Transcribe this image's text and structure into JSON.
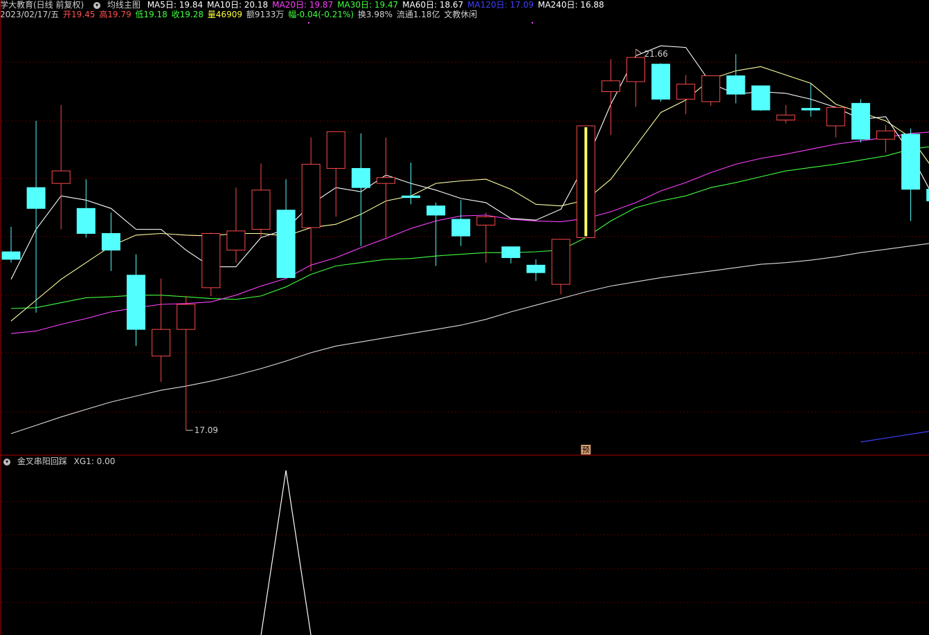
{
  "header": {
    "stock_name": "学大教育(日线 前复权)",
    "indicator_name": "均线主图",
    "ma": [
      {
        "label": "MA5日: 19.84",
        "color": "#ffffff"
      },
      {
        "label": "MA10日: 20.18",
        "color": "#ffffff"
      },
      {
        "label": "MA20日: 19.87",
        "color": "#ff40ff"
      },
      {
        "label": "MA30日: 19.47",
        "color": "#40ff40"
      },
      {
        "label": "MA60日: 18.67",
        "color": "#ffffff"
      },
      {
        "label": "MA120日: 17.09",
        "color": "#4040ff"
      },
      {
        "label": "MA240日: 16.88",
        "color": "#ffffff"
      }
    ]
  },
  "quote": {
    "date": "2023/02/17/五",
    "open": "开19.45",
    "high": "高19.79",
    "low": "低19.18",
    "close": "收19.28",
    "volume": "量46909",
    "amount": "额9133万",
    "change": "幅-0.04(-0.21%)",
    "turnover": "换3.98%",
    "float": "流通1.18亿",
    "sector": "文教休闲"
  },
  "sub_indicator": {
    "name": "金叉串阳回踩",
    "value_label": "XG1: 0.00"
  },
  "colors": {
    "up": "#ff4a4a",
    "down": "#54ffff",
    "highlight": "#ffff66",
    "grid": "#5a0000",
    "ma5": "#ffffff",
    "ma10": "#ffffa0",
    "ma20": "#ff40ff",
    "ma30": "#40ff40",
    "ma60": "#dddddd",
    "ma120": "#4040ff"
  },
  "chart_data": {
    "type": "candlestick",
    "ylim": [
      16.9,
      22.0
    ],
    "max_label": "21.66",
    "min_label": "17.09",
    "forecast_marker": "预",
    "candles": [
      {
        "o": 19.23,
        "h": 19.53,
        "l": 19.1,
        "c": 19.14
      },
      {
        "o": 20.0,
        "h": 20.8,
        "l": 18.5,
        "c": 19.75
      },
      {
        "o": 20.05,
        "h": 20.99,
        "l": 19.5,
        "c": 20.2
      },
      {
        "o": 19.75,
        "h": 20.1,
        "l": 19.4,
        "c": 19.45
      },
      {
        "o": 19.45,
        "h": 19.7,
        "l": 19.0,
        "c": 19.25
      },
      {
        "o": 18.95,
        "h": 19.2,
        "l": 18.1,
        "c": 18.3
      },
      {
        "o": 17.98,
        "h": 18.91,
        "l": 17.67,
        "c": 18.3
      },
      {
        "o": 18.3,
        "h": 18.7,
        "l": 17.09,
        "c": 18.6
      },
      {
        "o": 18.8,
        "h": 19.46,
        "l": 18.7,
        "c": 19.45
      },
      {
        "o": 19.25,
        "h": 20.0,
        "l": 19.1,
        "c": 19.48
      },
      {
        "o": 19.5,
        "h": 20.29,
        "l": 19.4,
        "c": 19.97
      },
      {
        "o": 19.73,
        "h": 20.1,
        "l": 19.5,
        "c": 18.92
      },
      {
        "o": 19.52,
        "h": 20.6,
        "l": 19.0,
        "c": 20.28
      },
      {
        "o": 20.23,
        "h": 20.56,
        "l": 19.65,
        "c": 20.67
      },
      {
        "o": 20.23,
        "h": 20.65,
        "l": 19.3,
        "c": 20.0
      },
      {
        "o": 20.05,
        "h": 20.6,
        "l": 19.4,
        "c": 20.12
      },
      {
        "o": 19.9,
        "h": 20.3,
        "l": 19.8,
        "c": 19.88
      },
      {
        "o": 19.78,
        "h": 19.82,
        "l": 19.06,
        "c": 19.67
      },
      {
        "o": 19.62,
        "h": 19.85,
        "l": 19.3,
        "c": 19.42
      },
      {
        "o": 19.55,
        "h": 19.7,
        "l": 19.1,
        "c": 19.65
      },
      {
        "o": 19.29,
        "h": 19.29,
        "l": 19.09,
        "c": 19.16
      },
      {
        "o": 19.07,
        "h": 19.14,
        "l": 18.88,
        "c": 18.98
      },
      {
        "o": 18.84,
        "h": 19.12,
        "l": 18.72,
        "c": 19.38
      },
      {
        "o": 19.4,
        "h": 20.74,
        "l": 19.4,
        "c": 20.74,
        "hl": true
      },
      {
        "o": 21.15,
        "h": 21.54,
        "l": 20.63,
        "c": 21.28
      },
      {
        "o": 21.27,
        "h": 21.66,
        "l": 20.97,
        "c": 21.56
      },
      {
        "o": 21.48,
        "h": 21.49,
        "l": 21.03,
        "c": 21.06
      },
      {
        "o": 21.06,
        "h": 21.35,
        "l": 20.88,
        "c": 21.24
      },
      {
        "o": 21.03,
        "h": 21.32,
        "l": 20.98,
        "c": 21.34
      },
      {
        "o": 21.34,
        "h": 21.6,
        "l": 21.01,
        "c": 21.12
      },
      {
        "o": 21.22,
        "h": 21.22,
        "l": 20.92,
        "c": 20.93
      },
      {
        "o": 20.81,
        "h": 20.99,
        "l": 20.77,
        "c": 20.87
      },
      {
        "o": 20.95,
        "h": 21.25,
        "l": 20.85,
        "c": 20.93
      },
      {
        "o": 20.74,
        "h": 20.98,
        "l": 20.6,
        "c": 20.96
      },
      {
        "o": 21.01,
        "h": 21.06,
        "l": 20.54,
        "c": 20.58
      },
      {
        "o": 20.58,
        "h": 20.75,
        "l": 20.42,
        "c": 20.68
      },
      {
        "o": 20.64,
        "h": 20.71,
        "l": 19.6,
        "c": 19.98
      },
      {
        "o": 19.98,
        "h": 20.15,
        "l": 19.8,
        "c": 19.84
      }
    ],
    "ma5": [
      18.9,
      19.5,
      19.9,
      19.85,
      19.75,
      19.5,
      19.5,
      19.25,
      19.05,
      19.05,
      19.4,
      19.5,
      19.8,
      20.0,
      19.95,
      20.15,
      20.05,
      19.97,
      19.87,
      19.82,
      19.63,
      19.61,
      19.74,
      20.3,
      21.0,
      21.58,
      21.7,
      21.68,
      21.25,
      21.12,
      21.15,
      21.13,
      21.06,
      20.96,
      20.82,
      20.85,
      20.4,
      19.84
    ],
    "ma10": [
      18.4,
      18.65,
      18.9,
      19.1,
      19.3,
      19.43,
      19.45,
      19.43,
      19.42,
      19.45,
      19.45,
      19.42,
      19.52,
      19.56,
      19.68,
      19.84,
      19.9,
      20.05,
      20.08,
      20.1,
      19.98,
      19.8,
      19.78,
      19.85,
      20.1,
      20.5,
      20.9,
      21.05,
      21.3,
      21.4,
      21.45,
      21.35,
      21.25,
      21.0,
      20.9,
      20.8,
      20.6,
      20.18
    ],
    "ma20": [
      18.25,
      18.28,
      18.36,
      18.43,
      18.51,
      18.56,
      18.6,
      18.61,
      18.63,
      18.71,
      18.82,
      18.91,
      19.07,
      19.16,
      19.28,
      19.39,
      19.51,
      19.6,
      19.66,
      19.67,
      19.62,
      19.6,
      19.59,
      19.63,
      19.71,
      19.82,
      19.96,
      20.06,
      20.18,
      20.28,
      20.35,
      20.4,
      20.46,
      20.52,
      20.56,
      20.6,
      20.65,
      20.67
    ],
    "ma30": [
      18.55,
      18.56,
      18.62,
      18.68,
      18.69,
      18.71,
      18.71,
      18.69,
      18.67,
      18.66,
      18.7,
      18.81,
      18.96,
      19.06,
      19.1,
      19.14,
      19.15,
      19.18,
      19.2,
      19.22,
      19.22,
      19.23,
      19.25,
      19.4,
      19.6,
      19.76,
      19.84,
      19.9,
      20.0,
      20.06,
      20.13,
      20.2,
      20.24,
      20.28,
      20.33,
      20.38,
      20.46,
      20.5
    ],
    "ma60": [
      17.05,
      17.15,
      17.25,
      17.34,
      17.43,
      17.5,
      17.57,
      17.62,
      17.68,
      17.75,
      17.83,
      17.92,
      18.02,
      18.1,
      18.15,
      18.2,
      18.25,
      18.3,
      18.35,
      18.42,
      18.51,
      18.59,
      18.67,
      18.75,
      18.82,
      18.87,
      18.92,
      18.96,
      19.0,
      19.04,
      19.08,
      19.1,
      19.13,
      19.17,
      19.22,
      19.26,
      19.3,
      19.34
    ],
    "ma120_tail": {
      "from_index": 34,
      "to_index": 37,
      "from_value": 16.95,
      "to_value": 17.09
    },
    "xg1": {
      "peak_index": 11,
      "value": 0.0
    }
  }
}
